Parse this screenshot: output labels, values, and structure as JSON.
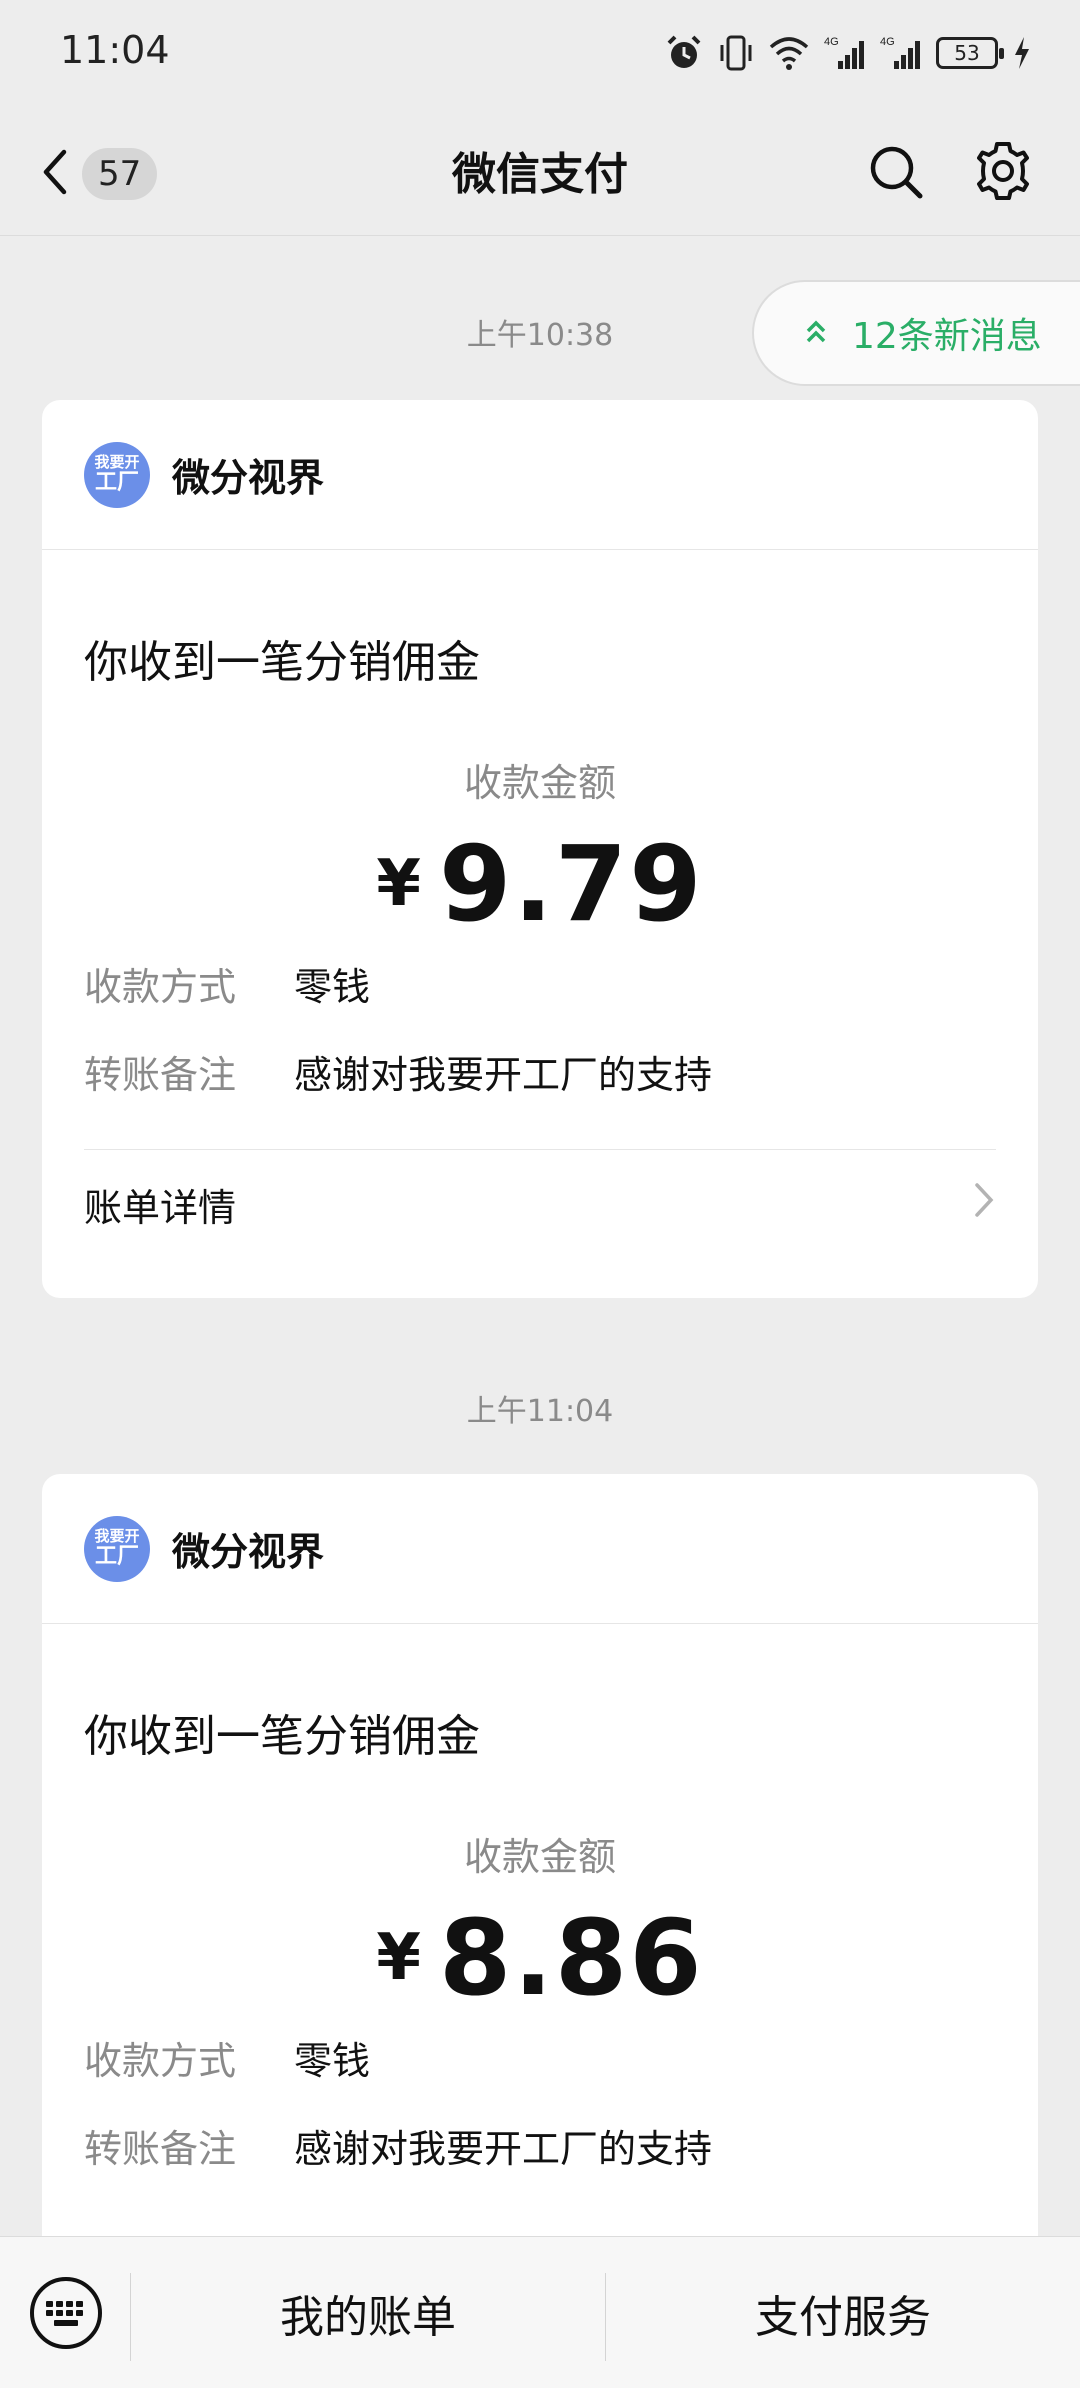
{
  "status": {
    "time": "11:04",
    "battery": "53",
    "net1": "4G",
    "net2": "4G"
  },
  "nav": {
    "unread_count": "57",
    "title": "微信支付"
  },
  "new_messages": {
    "label": "12条新消息"
  },
  "messages": [
    {
      "timestamp": "上午10:38",
      "sender": "微分视界",
      "avatar_line1": "我要开",
      "avatar_line2": "工厂",
      "title": "你收到一笔分销佣金",
      "amount_label": "收款金额",
      "currency": "¥",
      "amount": "9.79",
      "method_label": "收款方式",
      "method_value": "零钱",
      "note_label": "转账备注",
      "note_value": "感谢对我要开工厂的支持",
      "detail_label": "账单详情"
    },
    {
      "timestamp": "上午11:04",
      "sender": "微分视界",
      "avatar_line1": "我要开",
      "avatar_line2": "工厂",
      "title": "你收到一笔分销佣金",
      "amount_label": "收款金额",
      "currency": "¥",
      "amount": "8.86",
      "method_label": "收款方式",
      "method_value": "零钱",
      "note_label": "转账备注",
      "note_value": "感谢对我要开工厂的支持"
    }
  ],
  "bottom_bar": {
    "tab1": "我的账单",
    "tab2": "支付服务"
  },
  "colors": {
    "accent_green": "#2aae67",
    "avatar_blue": "#6b8fe8",
    "background": "#ededed"
  },
  "icons": [
    "alarm-icon",
    "vibrate-icon",
    "wifi-icon",
    "signal-icon",
    "battery-icon",
    "charging-icon",
    "back-chevron-icon",
    "search-icon",
    "gear-icon",
    "double-chevron-up-icon",
    "chevron-right-icon",
    "keyboard-icon"
  ]
}
